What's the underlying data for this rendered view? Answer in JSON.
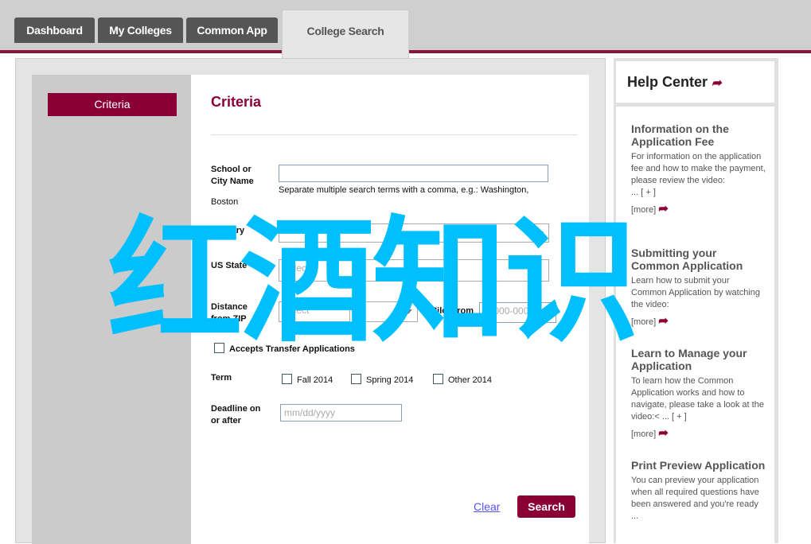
{
  "tabs": [
    {
      "label": "Dashboard"
    },
    {
      "label": "My Colleges"
    },
    {
      "label": "Common App"
    },
    {
      "label": "College Search"
    }
  ],
  "sidebar": {
    "criteria_button": "Criteria"
  },
  "form": {
    "title": "Criteria",
    "school_label": "School or City Name",
    "school_value": "",
    "school_hint": "Separate multiple search terms with a comma, e.g.: Washington,",
    "school_hint_example": "Boston",
    "country_label": "Country",
    "state_label": "US State",
    "state_placeholder": "Select",
    "distance_label": "Distance from ZIP",
    "distance_placeholder": "Select",
    "zip_label": "Miles from",
    "zip_placeholder": "00000-0000",
    "transfer_label": "Accepts Transfer Applications",
    "term_label": "Term",
    "terms": [
      "Fall 2014",
      "Spring 2014",
      "Other 2014"
    ],
    "deadline_label": "Deadline on or after",
    "deadline_placeholder": "mm/dd/yyyy",
    "clear": "Clear",
    "search": "Search"
  },
  "help": {
    "title": "Help Center",
    "sections": [
      {
        "title": "Information on the Application Fee",
        "desc": "For information on the application fee and how to make the payment, please review the video:",
        "expand": "... [ + ]",
        "more": "[more]"
      },
      {
        "title": "Submitting your Common Application",
        "desc": "Learn how to submit your Common Application by watching the video:",
        "more": "[more]"
      },
      {
        "title": "Learn to Manage your Application",
        "desc": "To learn how the Common Application works and how to navigate, please take a look at the video:< ... [ + ]",
        "more": "[more]"
      },
      {
        "title": "Print Preview Application",
        "desc": "You can preview your application when all required questions have been answered and you're ready ..."
      }
    ]
  },
  "watermark": "红酒知识",
  "colors": {
    "brand": "#8a0036",
    "watermark": "#00bfff"
  }
}
